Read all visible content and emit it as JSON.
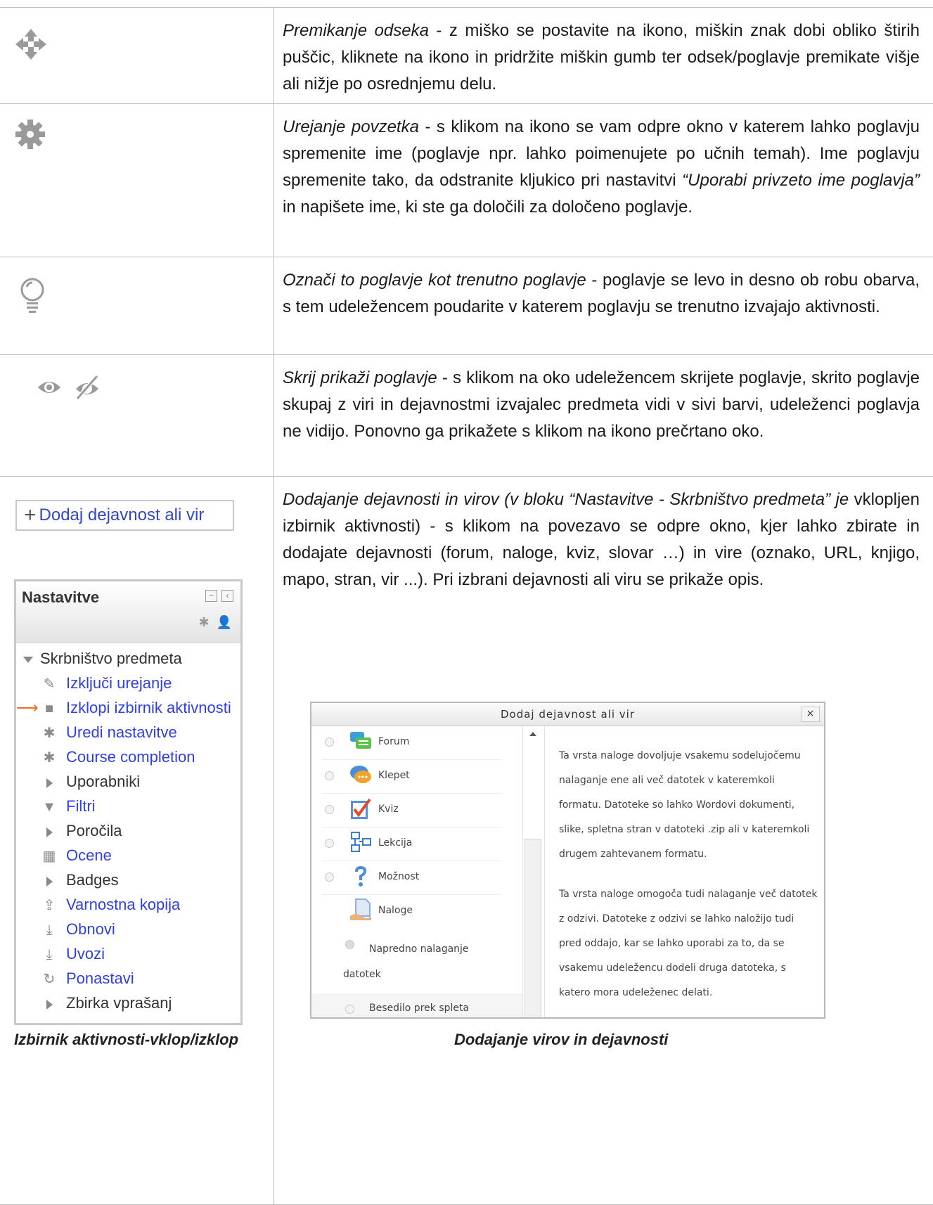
{
  "rows": [
    {
      "icon": "move-icon",
      "title": "Premikanje odseka",
      "text": " - z miško se postavite na ikono, miškin znak dobi obliko štirih puščic, kliknete na ikono in pridržite miškin gumb ter odsek/poglavje premikate višje ali nižje po osrednjemu delu."
    },
    {
      "icon": "gear-icon",
      "title": "Urejanje povzetka",
      "text_a": " - s klikom na ikono se vam odpre okno v katerem lahko poglavju spremenite ime (poglavje npr. lahko poimenujete po učnih temah). Ime poglavju spremenite tako, da odstranite kljukico pri nastavitvi ",
      "italic_b": "“Uporabi privzeto ime poglavja”",
      "text_c": " in napišete ime, ki ste ga določili za določeno poglavje."
    },
    {
      "icon": "lightbulb-icon",
      "title": "Označi to poglavje kot trenutno poglavje",
      "text": " - poglavje se levo in desno ob robu obarva, s tem udeležencem poudarite v katerem poglavju se trenutno izvajajo aktivnosti."
    },
    {
      "icon": "eye-icon",
      "title": "Skrij prikaži poglavje",
      "text": " - s klikom na oko udeležencem skrijete poglavje, skrito poglavje skupaj z viri in dejavnostmi izvajalec predmeta vidi v sivi barvi, udeleženci poglavja ne vidijo. Ponovno ga prikažete s klikom na ikono prečrtano oko."
    },
    {
      "title": "Dodajanje dejavnosti in virov (v bloku “Nastavitve - Skrbništvo predmeta”  je",
      "text": " vklopljen izbirnik aktivnosti) - s klikom na povezavo se odpre okno, kjer lahko zbirate in dodajate dejavnosti (forum, naloge, kviz, slovar …) in vire (oznako, URL, knjigo, mapo, stran, vir ...). Pri izbrani dejavnosti ali viru se prikaže opis."
    }
  ],
  "add_button": {
    "label": "Dodaj dejavnost ali vir"
  },
  "settings_block": {
    "title": "Nastavitve",
    "root": "Skrbništvo predmeta",
    "items": [
      {
        "label": "Izključi urejanje",
        "icon": "pencil-icon",
        "link": true
      },
      {
        "label": "Izklopi izbirnik aktivnosti",
        "icon": "bullet-icon",
        "link": true
      },
      {
        "label": "Uredi nastavitve",
        "icon": "gear-icon",
        "link": true
      },
      {
        "label": "Course completion",
        "icon": "gear-icon",
        "link": true
      },
      {
        "label": "Uporabniki",
        "icon": "expand-icon",
        "link": false
      },
      {
        "label": "Filtri",
        "icon": "filter-icon",
        "link": true
      },
      {
        "label": "Poročila",
        "icon": "expand-icon",
        "link": false
      },
      {
        "label": "Ocene",
        "icon": "grades-icon",
        "link": true
      },
      {
        "label": "Badges",
        "icon": "expand-icon",
        "link": false
      },
      {
        "label": "Varnostna kopija",
        "icon": "backup-icon",
        "link": true
      },
      {
        "label": "Obnovi",
        "icon": "restore-icon",
        "link": true
      },
      {
        "label": "Uvozi",
        "icon": "import-icon",
        "link": true
      },
      {
        "label": "Ponastavi",
        "icon": "reset-icon",
        "link": true
      },
      {
        "label": "Zbirka vprašanj",
        "icon": "expand-icon",
        "link": true
      }
    ],
    "caption": "Izbirnik aktivnosti-vklop/izklop"
  },
  "dialog": {
    "title": "Dodaj dejavnost ali vir",
    "close": "×",
    "items": [
      "Forum",
      "Klepet",
      "Kviz",
      "Lekcija",
      "Možnost",
      "Naloge"
    ],
    "selected_line1": "Napredno nalaganje",
    "selected_line2": "datotek",
    "last_item": "Besedilo prek spleta",
    "description": [
      "Ta vrsta naloge dovoljuje vsakemu sodelujočemu nalaganje ene ali več datotek v kateremkoli formatu. Datoteke so lahko Wordovi dokumenti, slike, spletna stran v datoteki .zip ali v kateremkoli drugem zahtevanem formatu.",
      "Ta vrsta naloge omogoča tudi nalaganje več datotek z odzivi. Datoteke z odzivi se lahko naložijo tudi pred oddajo, kar se lahko uporabi za to, da se vsakemu udeležencu dodeli druga datoteka, s katero mora udeleženec delati."
    ],
    "caption": "Dodajanje virov in dejavnosti"
  }
}
